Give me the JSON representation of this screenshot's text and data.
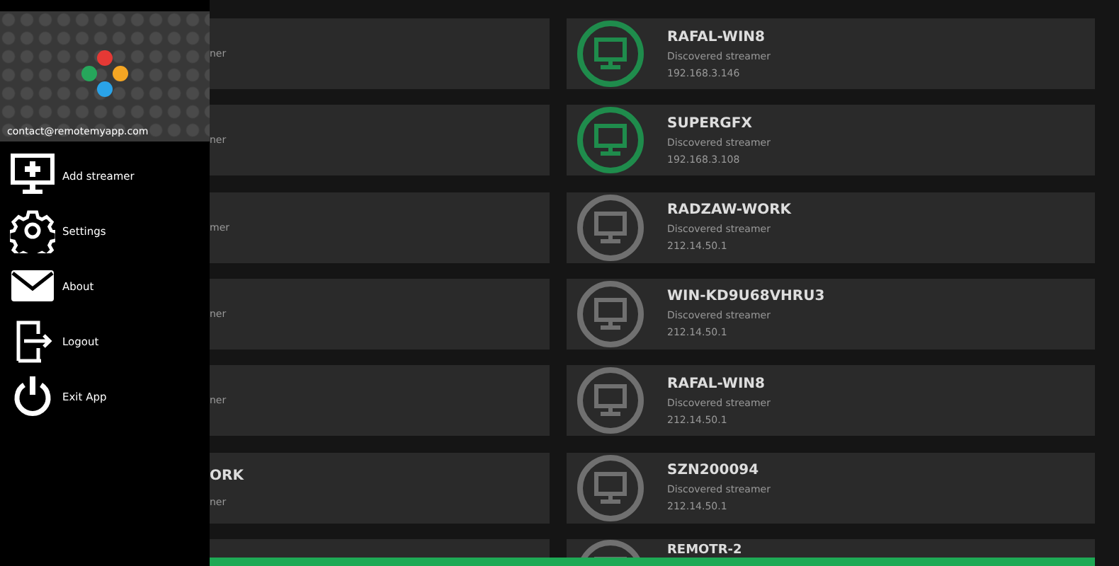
{
  "drawer": {
    "email": "contact@remotemyapp.com",
    "menu": [
      {
        "kind": "add",
        "label": "Add streamer"
      },
      {
        "kind": "settings",
        "label": "Settings"
      },
      {
        "kind": "about",
        "label": "About"
      },
      {
        "kind": "logout",
        "label": "Logout"
      },
      {
        "kind": "exit",
        "label": "Exit App"
      }
    ]
  },
  "left_cards": [
    {
      "subtitle": "ner"
    },
    {
      "subtitle": "ner"
    },
    {
      "subtitle": "mer"
    },
    {
      "subtitle": "ner"
    },
    {
      "subtitle": "ner"
    },
    {
      "title": "ORK",
      "subtitle": "ner"
    }
  ],
  "streamers": [
    {
      "name": "RAFAL-WIN8",
      "type": "Discovered streamer",
      "address": "192.168.3.146",
      "online": true
    },
    {
      "name": "SUPERGFX",
      "type": "Discovered streamer",
      "address": "192.168.3.108",
      "online": true
    },
    {
      "name": "RADZAW-WORK",
      "type": "Discovered streamer",
      "address": "212.14.50.1",
      "online": false
    },
    {
      "name": "WIN-KD9U68VHRU3",
      "type": "Discovered streamer",
      "address": "212.14.50.1",
      "online": false
    },
    {
      "name": "RAFAL-WIN8",
      "type": "Discovered streamer",
      "address": "212.14.50.1",
      "online": false
    },
    {
      "name": "SZN200094",
      "type": "Discovered streamer",
      "address": "212.14.50.1",
      "online": false
    },
    {
      "name": "REMOTR-2",
      "online": false
    }
  ]
}
